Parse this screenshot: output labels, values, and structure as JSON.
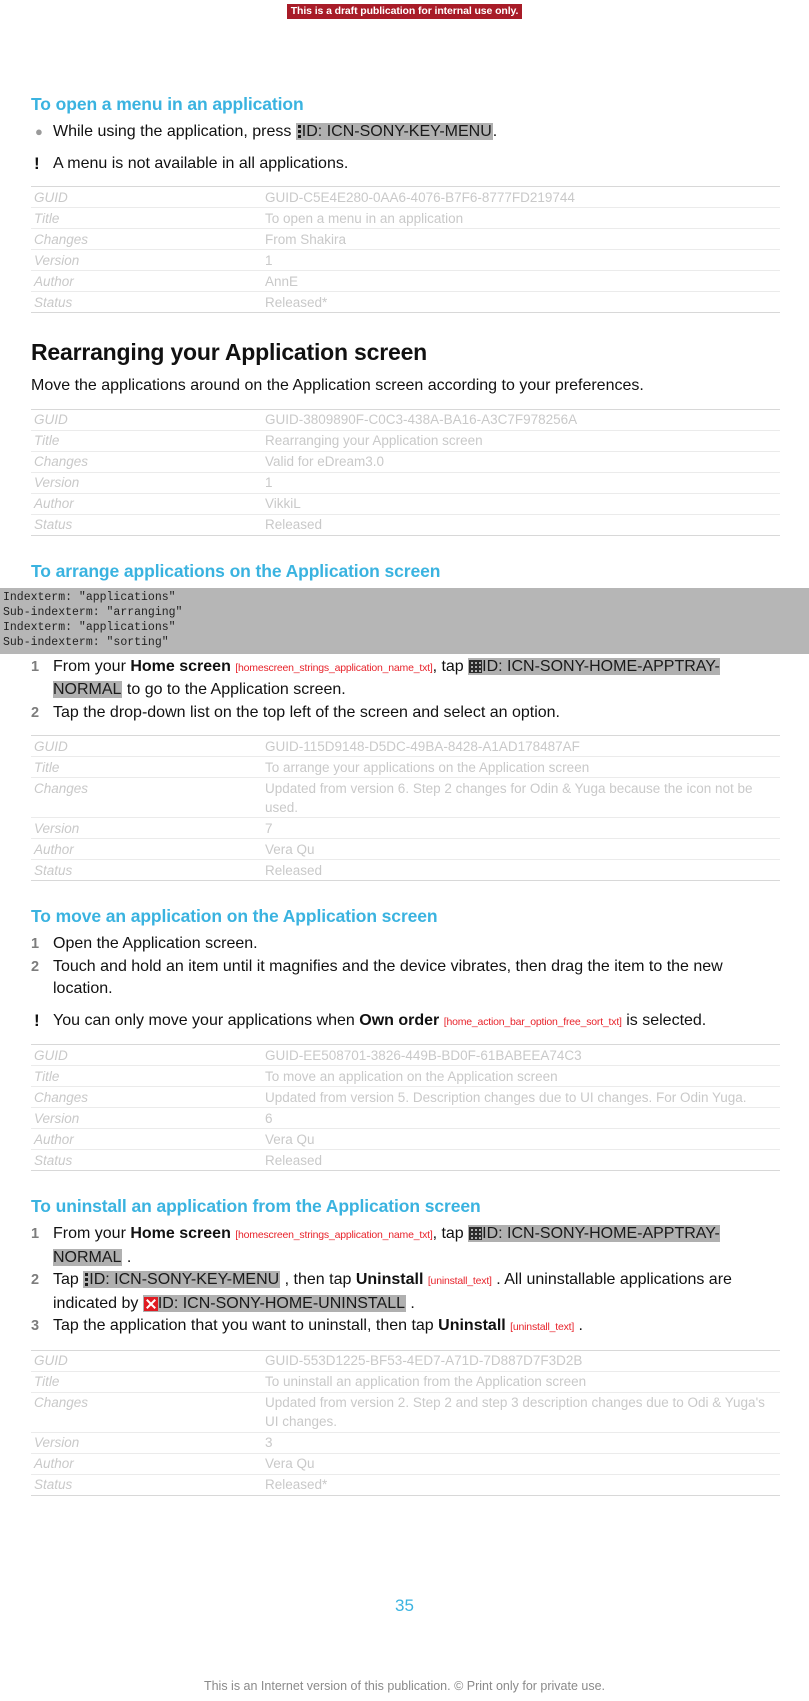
{
  "banner": {
    "text": "This is a draft publication for internal use only.",
    "bg_color": "#a81c28",
    "text_color": "#ffffff"
  },
  "colors": {
    "task_heading": "#3ab3e0",
    "token_highlight": "#b0b0b0",
    "string_id": "#e8242c",
    "page_number": "#3ab3e0",
    "meta_text": "#c9c9c9",
    "uninstall_icon": "#e01b22"
  },
  "sections": [
    {
      "task_heading": "To open a menu in an application",
      "bullet": {
        "pre": "While using the application, press ",
        "token": "ID: ICN-SONY-KEY-MENU",
        "post": "."
      },
      "note": "A menu is not available in all applications.",
      "meta": {
        "labels": [
          "GUID",
          "Title",
          "Changes",
          "Version",
          "Author",
          "Status"
        ],
        "values": [
          "GUID-C5E4E280-0AA6-4076-B7F6-8777FD219744",
          "To open a menu in an application",
          "From Shakira",
          "1",
          "AnnE",
          "Released*"
        ]
      }
    },
    {
      "section_heading": "Rearranging your Application screen",
      "intro": "Move the applications around on the Application screen according to your preferences.",
      "meta": {
        "labels": [
          "GUID",
          "Title",
          "Changes",
          "Version",
          "Author",
          "Status"
        ],
        "values": [
          "GUID-3809890F-C0C3-438A-BA16-A3C7F978256A",
          "Rearranging your Application screen",
          "Valid for eDream3.0",
          "1",
          "VikkiL",
          "Released"
        ]
      }
    },
    {
      "task_heading": "To arrange applications on the Application screen",
      "indexterm_lines": [
        "Indexterm: \"applications\"",
        "Sub-indexterm: \"arranging\"",
        "Indexterm: \"applications\"",
        "Sub-indexterm: \"sorting\""
      ],
      "steps": [
        {
          "num": "1",
          "p1": "From your ",
          "ui1": "Home screen",
          "sid1": "[homescreen_strings_application_name_txt]",
          "p2": ", tap ",
          "token": "ID: ICN-SONY-HOME-APPTRAY-NORMAL",
          "p3": " to go to the Application screen."
        },
        {
          "num": "2",
          "p1": "Tap the drop-down list on the top left of the screen and select an option."
        }
      ],
      "meta": {
        "labels": [
          "GUID",
          "Title",
          "Changes",
          "Version",
          "Author",
          "Status"
        ],
        "values": [
          "GUID-115D9148-D5DC-49BA-8428-A1AD178487AF",
          "To arrange your applications on the Application screen",
          "Updated from version 6. Step 2 changes for Odin & Yuga because the icon not be used.",
          "7",
          "Vera Qu",
          "Released"
        ]
      }
    },
    {
      "task_heading": "To move an application on the Application screen",
      "steps": [
        {
          "num": "1",
          "p1": "Open the Application screen."
        },
        {
          "num": "2",
          "p1": "Touch and hold an item until it magnifies and the device vibrates, then drag the item to the new location."
        }
      ],
      "note_rich": {
        "pre": "You can only move your applications when ",
        "ui": "Own order",
        "sid": "[home_action_bar_option_free_sort_txt]",
        "post": " is selected."
      },
      "meta": {
        "labels": [
          "GUID",
          "Title",
          "Changes",
          "Version",
          "Author",
          "Status"
        ],
        "values": [
          "GUID-EE508701-3826-449B-BD0F-61BABEEA74C3",
          "To move an application on the Application screen",
          "Updated from version 5. Description changes due to UI changes. For Odin Yuga.",
          "6",
          "Vera Qu",
          "Released"
        ]
      }
    },
    {
      "task_heading": "To uninstall an application from the Application screen",
      "steps": [
        {
          "num": "1",
          "p1": "From your ",
          "ui1": "Home screen",
          "sid1": "[homescreen_strings_application_name_txt]",
          "p2": ", tap ",
          "token": "ID: ICN-SONY-HOME-APPTRAY-NORMAL",
          "p3": " ."
        },
        {
          "num": "2",
          "p1": "Tap ",
          "token1": "ID: ICN-SONY-KEY-MENU",
          "p2": " , then tap ",
          "ui1": "Uninstall",
          "sid1": "[uninstall_text]",
          "p3": " . All uninstallable applications are indicated by ",
          "token2": "ID: ICN-SONY-HOME-UNINSTALL",
          "p4": " ."
        },
        {
          "num": "3",
          "p1": "Tap the application that you want to uninstall, then tap ",
          "ui1": "Uninstall",
          "sid1": "[uninstall_text]",
          "p2": " ."
        }
      ],
      "meta": {
        "labels": [
          "GUID",
          "Title",
          "Changes",
          "Version",
          "Author",
          "Status"
        ],
        "values": [
          "GUID-553D1225-BF53-4ED7-A71D-7D887D7F3D2B",
          "To uninstall an application from the Application screen",
          "Updated from version 2. Step 2 and step 3 description changes due to Odi & Yuga's UI changes.",
          "3",
          "Vera Qu",
          "Released*"
        ]
      }
    }
  ],
  "footer": {
    "page_number": "35",
    "note": "This is an Internet version of this publication. © Print only for private use."
  }
}
